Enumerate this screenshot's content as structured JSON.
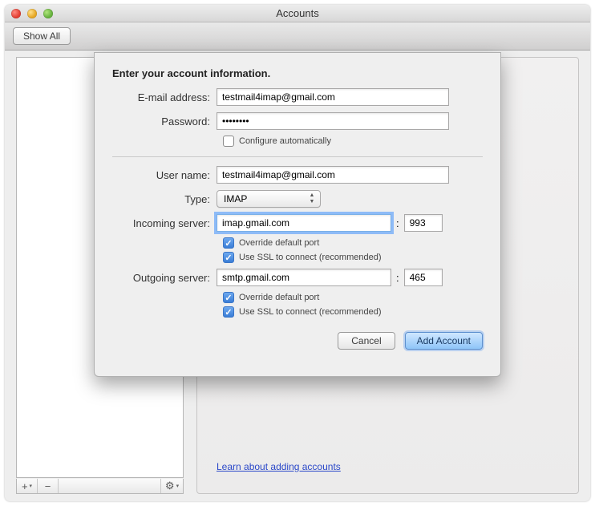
{
  "window": {
    "title": "Accounts",
    "toolbar": {
      "show_all": "Show All"
    },
    "sidebar_buttons": {
      "add": "+",
      "remove": "−",
      "options": "✱"
    },
    "learn_link": "Learn about adding accounts"
  },
  "sheet": {
    "heading": "Enter your account information.",
    "labels": {
      "email": "E-mail address:",
      "password": "Password:",
      "configure_auto": "Configure automatically",
      "username": "User name:",
      "type": "Type:",
      "incoming": "Incoming server:",
      "outgoing": "Outgoing server:",
      "override_port": "Override default port",
      "use_ssl": "Use SSL to connect (recommended)"
    },
    "values": {
      "email": "testmail4imap@gmail.com",
      "password": "••••••••",
      "username": "testmail4imap@gmail.com",
      "type": "IMAP",
      "incoming_server": "imap.gmail.com",
      "incoming_port": "993",
      "outgoing_server": "smtp.gmail.com",
      "outgoing_port": "465"
    },
    "buttons": {
      "cancel": "Cancel",
      "add_account": "Add Account"
    }
  }
}
